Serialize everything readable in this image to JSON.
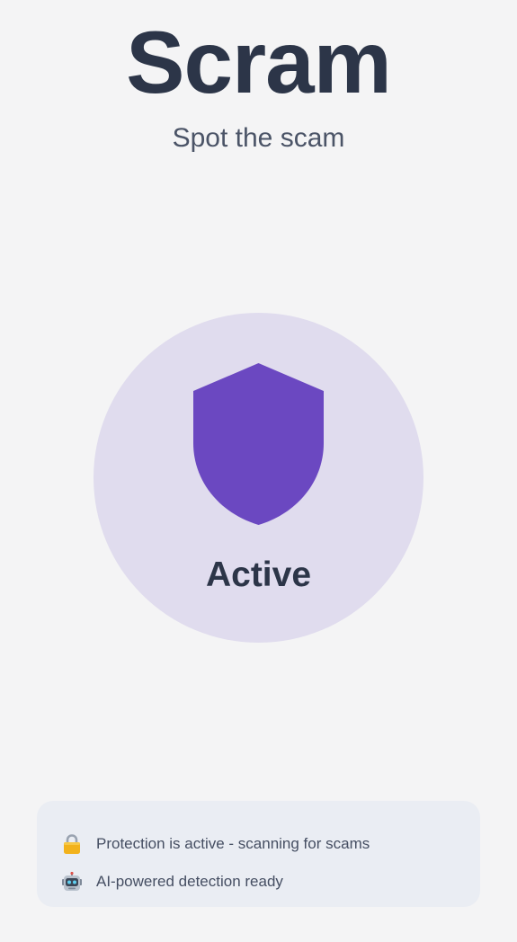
{
  "app": {
    "title": "Scram",
    "subtitle": "Spot the scam"
  },
  "status": {
    "label": "Active",
    "icon": "shield-icon",
    "accent_color": "#6b48c1",
    "circle_color": "#e0dcee"
  },
  "info": {
    "items": [
      {
        "icon": "lock-icon",
        "text": "Protection is active - scanning for scams"
      },
      {
        "icon": "robot-icon",
        "text": "AI-powered detection ready"
      }
    ]
  }
}
